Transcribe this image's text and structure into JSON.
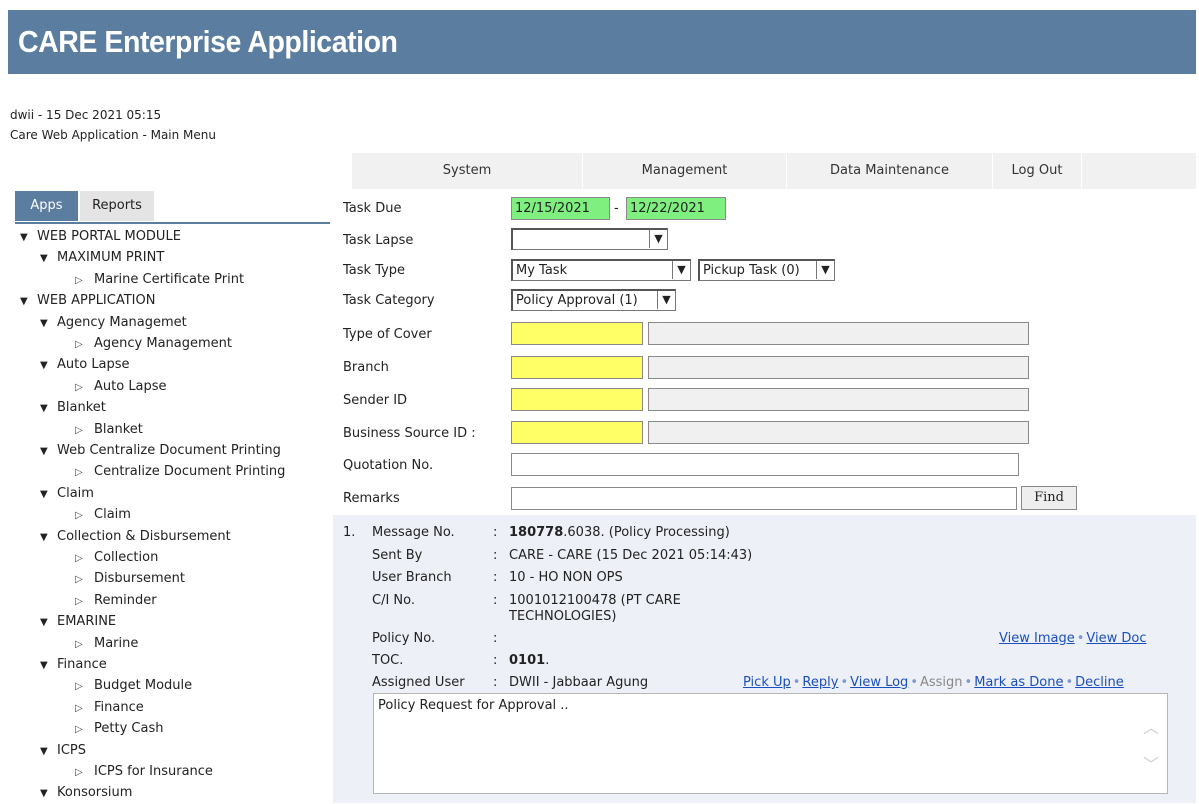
{
  "app": {
    "title": "CARE Enterprise Application"
  },
  "session": {
    "user_date": "dwii - 15 Dec 2021 05:15",
    "location": "Care Web Application - Main Menu"
  },
  "menu": {
    "items": [
      "System",
      "Management",
      "Data Maintenance",
      "Log Out"
    ]
  },
  "sidebar": {
    "tabs": [
      "Apps",
      "Reports"
    ],
    "active_tab": "Apps",
    "tree": [
      {
        "level": 0,
        "label": "WEB PORTAL MODULE",
        "type": "open"
      },
      {
        "level": 1,
        "label": "MAXIMUM PRINT",
        "type": "open"
      },
      {
        "level": 2,
        "label": "Marine Certificate Print",
        "type": "leaf"
      },
      {
        "level": 0,
        "label": "WEB APPLICATION",
        "type": "open"
      },
      {
        "level": 1,
        "label": "Agency Managemet",
        "type": "open"
      },
      {
        "level": 2,
        "label": "Agency Management",
        "type": "leaf"
      },
      {
        "level": 1,
        "label": "Auto Lapse",
        "type": "open"
      },
      {
        "level": 2,
        "label": "Auto Lapse",
        "type": "leaf"
      },
      {
        "level": 1,
        "label": "Blanket",
        "type": "open"
      },
      {
        "level": 2,
        "label": "Blanket",
        "type": "leaf"
      },
      {
        "level": 1,
        "label": "Web Centralize Document Printing",
        "type": "open"
      },
      {
        "level": 2,
        "label": "Centralize Document Printing",
        "type": "leaf"
      },
      {
        "level": 1,
        "label": "Claim",
        "type": "open"
      },
      {
        "level": 2,
        "label": "Claim",
        "type": "leaf"
      },
      {
        "level": 1,
        "label": "Collection & Disbursement",
        "type": "open"
      },
      {
        "level": 2,
        "label": "Collection",
        "type": "leaf"
      },
      {
        "level": 2,
        "label": "Disbursement",
        "type": "leaf"
      },
      {
        "level": 2,
        "label": "Reminder",
        "type": "leaf"
      },
      {
        "level": 1,
        "label": "EMARINE",
        "type": "open"
      },
      {
        "level": 2,
        "label": "Marine",
        "type": "leaf"
      },
      {
        "level": 1,
        "label": "Finance",
        "type": "open"
      },
      {
        "level": 2,
        "label": "Budget Module",
        "type": "leaf"
      },
      {
        "level": 2,
        "label": "Finance",
        "type": "leaf"
      },
      {
        "level": 2,
        "label": "Petty Cash",
        "type": "leaf"
      },
      {
        "level": 1,
        "label": "ICPS",
        "type": "open"
      },
      {
        "level": 2,
        "label": "ICPS for Insurance",
        "type": "leaf"
      },
      {
        "level": 1,
        "label": "Konsorsium",
        "type": "open"
      }
    ]
  },
  "form": {
    "task_due_label": "Task Due",
    "task_due_from": "12/15/2021",
    "task_due_sep": "-",
    "task_due_to": "12/22/2021",
    "task_lapse_label": "Task Lapse",
    "task_lapse_value": "",
    "task_type_label": "Task Type",
    "task_type_value": "My Task",
    "pickup_value": "Pickup Task (0)",
    "task_category_label": "Task Category",
    "task_category_value": "Policy Approval (1)",
    "type_of_cover_label": "Type of Cover",
    "branch_label": "Branch",
    "sender_id_label": "Sender ID",
    "business_source_label": "Business Source ID :",
    "quotation_label": "Quotation No.",
    "remarks_label": "Remarks",
    "find_label": "Find"
  },
  "message": {
    "index": "1.",
    "message_no_label": "Message No.",
    "message_no_bold": "180778",
    "message_no_rest": ".6038. (Policy Processing)",
    "sent_by_label": "Sent By",
    "sent_by_value": "CARE - CARE (15 Dec 2021 05:14:43)",
    "user_branch_label": "User Branch",
    "user_branch_value": "10 - HO NON OPS",
    "ci_label": "C/I No.",
    "ci_line1": "1001012100478 (PT CARE",
    "ci_line2": "TECHNOLOGIES)",
    "policy_label": "Policy No.",
    "policy_value": "",
    "toc_label": "TOC.",
    "toc_bold": "0101",
    "toc_rest": ".",
    "assigned_label": "Assigned User",
    "assigned_value": "DWII - Jabbaar Agung",
    "colon": ":",
    "view_image": "View Image",
    "view_doc": "View Doc",
    "pick_up": "Pick Up",
    "reply": "Reply",
    "view_log": "View Log",
    "assign": "Assign",
    "mark_done": "Mark as Done",
    "decline": "Decline",
    "dot": "•",
    "body_text": "Policy Request for Approval .."
  },
  "colors": {
    "banner": "#5a7da0",
    "green_input": "#7ff07f",
    "yellow_input": "#ffff66",
    "link": "#1a4fbf",
    "message_panel": "#eef0f8"
  }
}
